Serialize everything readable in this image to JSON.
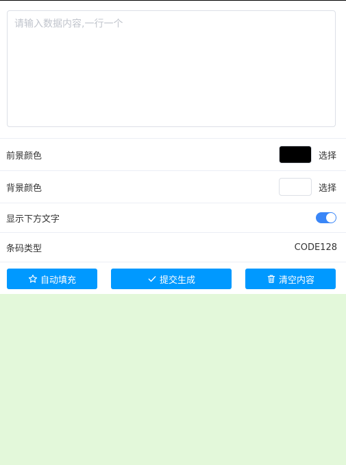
{
  "input": {
    "placeholder": "请输入数据内容,一行一个",
    "value": ""
  },
  "settings": {
    "foreground": {
      "label": "前景颜色",
      "color": "#000000",
      "action": "选择"
    },
    "background": {
      "label": "背景颜色",
      "color": "#ffffff",
      "action": "选择"
    },
    "show_text": {
      "label": "显示下方文字",
      "enabled": true,
      "color": "#3a86f7"
    },
    "barcode_type": {
      "label": "条码类型",
      "value": "CODE128"
    }
  },
  "buttons": {
    "color": "#0099ff",
    "autofill": {
      "label": "自动填充",
      "icon": "star-icon"
    },
    "submit": {
      "label": "提交生成",
      "icon": "check-icon"
    },
    "clear": {
      "label": "清空内容",
      "icon": "trash-icon"
    }
  },
  "result_area": {
    "background": "#e3f8da"
  }
}
